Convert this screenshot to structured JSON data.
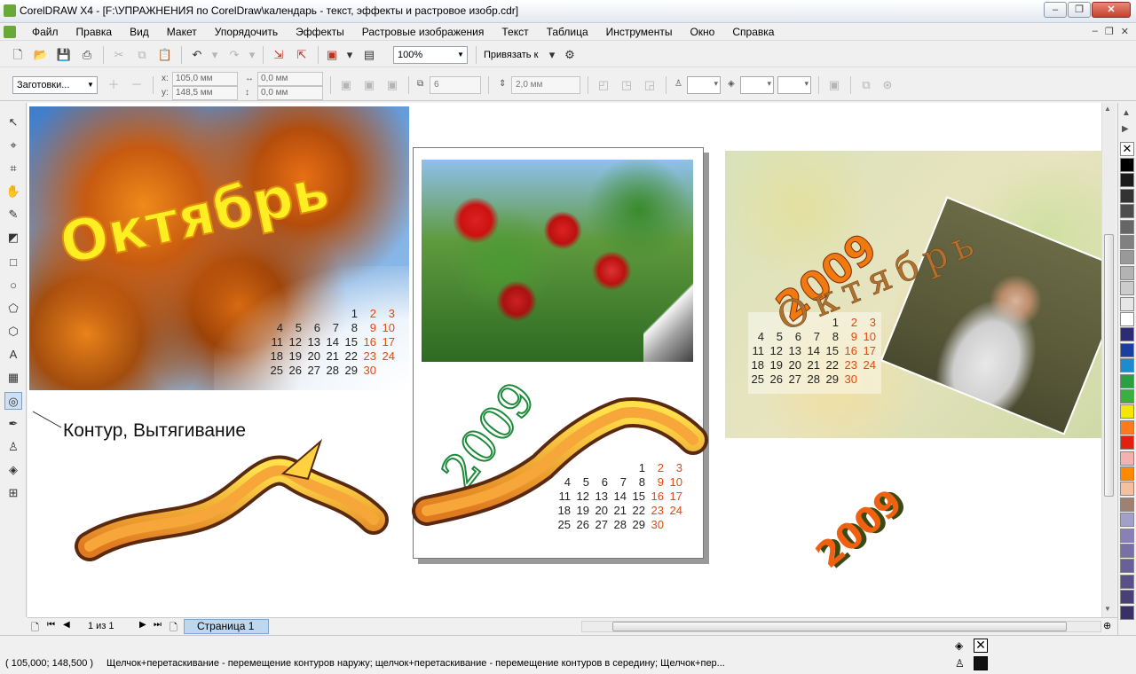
{
  "window": {
    "title": "CorelDRAW X4 - [F:\\УПРАЖНЕНИЯ по CorelDraw\\календарь - текст, эффекты и растровое изобр.cdr]",
    "min_label": "–",
    "max_label": "❐",
    "close_label": "✕"
  },
  "menu": [
    "Файл",
    "Правка",
    "Вид",
    "Макет",
    "Упорядочить",
    "Эффекты",
    "Растровые изображения",
    "Текст",
    "Таблица",
    "Инструменты",
    "Окно",
    "Справка"
  ],
  "toolbar": {
    "zoom": "100%",
    "snap_label": "Привязать к"
  },
  "property_bar": {
    "presets": "Заготовки...",
    "x_label": "x:",
    "x_value": "105,0 мм",
    "y_label": "y:",
    "y_value": "148,5 мм",
    "w_value": "0,0 мм",
    "h_value": "0,0 мм",
    "steps": "6",
    "offset": "2,0 мм"
  },
  "canvas": {
    "title_text": "Октябрь",
    "year_text": "2009",
    "annotation": "Контур, Вытягивание",
    "calendar": {
      "rows": [
        [
          {
            "d": "1",
            "r": false
          },
          {
            "d": "2",
            "r": true
          },
          {
            "d": "3",
            "r": true
          }
        ],
        [
          {
            "d": "4",
            "r": false
          },
          {
            "d": "5",
            "r": false
          },
          {
            "d": "6",
            "r": false
          },
          {
            "d": "7",
            "r": false
          },
          {
            "d": "8",
            "r": false
          },
          {
            "d": "9",
            "r": true
          },
          {
            "d": "10",
            "r": true
          }
        ],
        [
          {
            "d": "11",
            "r": false
          },
          {
            "d": "12",
            "r": false
          },
          {
            "d": "13",
            "r": false
          },
          {
            "d": "14",
            "r": false
          },
          {
            "d": "15",
            "r": false
          },
          {
            "d": "16",
            "r": true
          },
          {
            "d": "17",
            "r": true
          }
        ],
        [
          {
            "d": "18",
            "r": false
          },
          {
            "d": "19",
            "r": false
          },
          {
            "d": "20",
            "r": false
          },
          {
            "d": "21",
            "r": false
          },
          {
            "d": "22",
            "r": false
          },
          {
            "d": "23",
            "r": true
          },
          {
            "d": "24",
            "r": true
          }
        ],
        [
          {
            "d": "25",
            "r": false
          },
          {
            "d": "26",
            "r": false
          },
          {
            "d": "27",
            "r": false
          },
          {
            "d": "28",
            "r": false
          },
          {
            "d": "29",
            "r": false
          },
          {
            "d": "30",
            "r": true
          }
        ]
      ]
    }
  },
  "pagebar": {
    "page_count": "1 из 1",
    "page_tab": "Страница 1"
  },
  "status": {
    "coords": "( 105,000; 148,500 )",
    "message": "Щелчок+перетаскивание - перемещение контуров наружу; щелчок+перетаскивание - перемещение контуров в середину; Щелчок+пер..."
  },
  "colors": {
    "accent_orange": "#e04a10",
    "year_green": "#1d8a3a",
    "title_yellow": "#ffee22",
    "palette": [
      "#ffffff",
      "#000000",
      "#1a1a1a",
      "#333333",
      "#4d4d4d",
      "#666666",
      "#808080",
      "#999999",
      "#b3b3b3",
      "#cccccc",
      "#e6e6e6",
      "#ffffff",
      "#2e2a7a",
      "#1a3fa0",
      "#1e8ad0",
      "#2aa040",
      "#3ab040",
      "#f5e800",
      "#ff7a1a",
      "#e02010",
      "#f5b0b0",
      "#ff8a00",
      "#f4c0a0",
      "#a08070",
      "#a0a0c8",
      "#8a80b8",
      "#7a70a8",
      "#6a6098",
      "#5a5088",
      "#4a4078",
      "#3a3068"
    ]
  }
}
